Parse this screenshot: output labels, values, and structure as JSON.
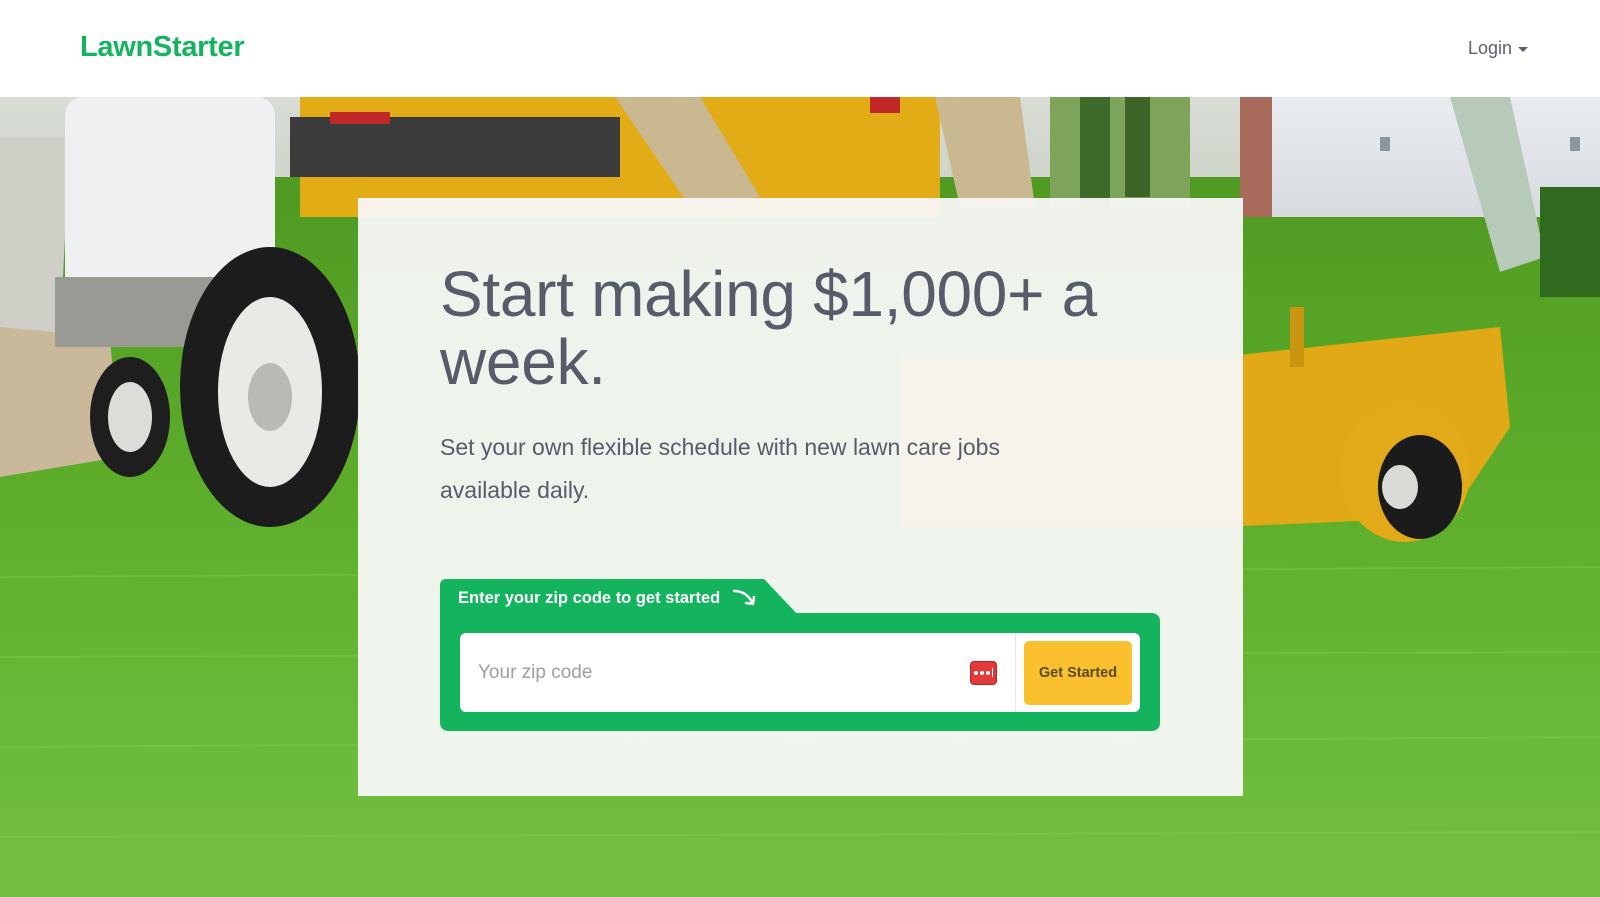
{
  "header": {
    "logo_text": "LawnStarter",
    "login_label": "Login"
  },
  "hero": {
    "headline": "Start making $1,000+ a week.",
    "subtext": "Set your own flexible schedule with new lawn care jobs available daily."
  },
  "zip_form": {
    "tab_label": "Enter your zip code to get started",
    "input_placeholder": "Your zip code",
    "input_value": "",
    "submit_label": "Get Started"
  },
  "colors": {
    "brand_green": "#14b45f",
    "button_yellow": "#fbc02d",
    "text_gray": "#575c6b"
  }
}
